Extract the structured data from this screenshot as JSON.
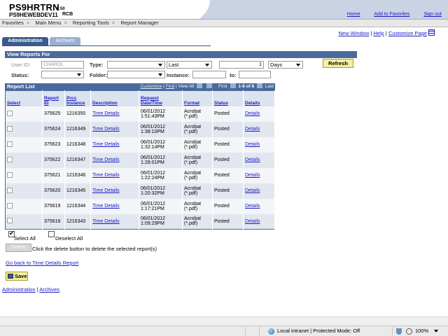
{
  "header": {
    "app_name": "PS9HRTRN",
    "version": "8.50",
    "database": "PS9HEWEBDEV11",
    "user_code": "RCB",
    "links": [
      "Home",
      "Add to Favorites",
      "Sign out"
    ]
  },
  "nav": {
    "items": [
      "Favorites",
      "Main Menu",
      "Reporting Tools",
      "Report Manager"
    ],
    "separator": ">"
  },
  "page_links": [
    "New Window",
    "Help",
    "Customize Page"
  ],
  "tabs": [
    {
      "label": "Administration",
      "active": true
    },
    {
      "label": "Archives",
      "active": false
    }
  ],
  "view_reports_for": {
    "title": "View Reports For",
    "user_id_label": "User ID:",
    "user_id_value": "CHAROL",
    "type_label": "Type:",
    "type_value": "",
    "last_value": "Last",
    "count_value": "1",
    "units_value": "Days",
    "refresh_label": "Refresh",
    "status_label": "Status:",
    "status_value": "",
    "folder_label": "Folder:",
    "folder_value": "",
    "instance_label": "Instance:",
    "instance_from": "",
    "to_label": "to:",
    "instance_to": ""
  },
  "report_list": {
    "title": "Report List",
    "tools": {
      "customize": "Customize",
      "find": "Find",
      "view_all": "View All",
      "first": "First",
      "range": "1-8 of 8",
      "last": "Last"
    },
    "columns": [
      "Select",
      "Report ID",
      "Prcs Instance",
      "Description",
      "Request Date/Time",
      "Format",
      "Status",
      "Details"
    ],
    "rows": [
      {
        "report_id": "375625",
        "instance": "1216350",
        "description": "Time Details",
        "date": "06/01/2012",
        "time": "1:51:43PM",
        "format1": "Acrobat",
        "format2": "(*.pdf)",
        "status": "Posted",
        "details": "Details"
      },
      {
        "report_id": "375624",
        "instance": "1216349",
        "description": "Time Details",
        "date": "06/01/2012",
        "time": "1:38:10PM",
        "format1": "Acrobat",
        "format2": "(*.pdf)",
        "status": "Posted",
        "details": "Details"
      },
      {
        "report_id": "375623",
        "instance": "1216348",
        "description": "Time Details",
        "date": "06/01/2012",
        "time": "1:32:14PM",
        "format1": "Acrobat",
        "format2": "(*.pdf)",
        "status": "Posted",
        "details": "Details"
      },
      {
        "report_id": "375622",
        "instance": "1216347",
        "description": "Time Details",
        "date": "06/01/2012",
        "time": "1:28:01PM",
        "format1": "Acrobat",
        "format2": "(*.pdf)",
        "status": "Posted",
        "details": "Details"
      },
      {
        "report_id": "375621",
        "instance": "1216346",
        "description": "Time Details",
        "date": "06/01/2012",
        "time": "1:22:24PM",
        "format1": "Acrobat",
        "format2": "(*.pdf)",
        "status": "Posted",
        "details": "Details"
      },
      {
        "report_id": "375620",
        "instance": "1216345",
        "description": "Time Details",
        "date": "06/01/2012",
        "time": "1:20:32PM",
        "format1": "Acrobat",
        "format2": "(*.pdf)",
        "status": "Posted",
        "details": "Details"
      },
      {
        "report_id": "375619",
        "instance": "1216344",
        "description": "Time Details",
        "date": "06/01/2012",
        "time": "1:17:21PM",
        "format1": "Acrobat",
        "format2": "(*.pdf)",
        "status": "Posted",
        "details": "Details"
      },
      {
        "report_id": "375618",
        "instance": "1216343",
        "description": "Time Details",
        "date": "06/01/2012",
        "time": "1:09:29PM",
        "format1": "Acrobat",
        "format2": "(*.pdf)",
        "status": "Posted",
        "details": "Details"
      }
    ]
  },
  "actions": {
    "select_all": "Select All",
    "deselect_all": "Deselect All",
    "delete_label": "Delete",
    "delete_msg": "Click the delete button to delete the selected report(s)",
    "go_back": "Go back to Time Details Report",
    "save_label": "Save"
  },
  "bottom_links": [
    "Administration",
    "Archives"
  ],
  "statusbar": {
    "zone": "Local intranet | Protected Mode: Off",
    "zoom": "100%"
  },
  "colors": {
    "header_blue": "#4a6a9c",
    "link": "#1a1ac8",
    "button_yellow": "#f4f0a0"
  }
}
